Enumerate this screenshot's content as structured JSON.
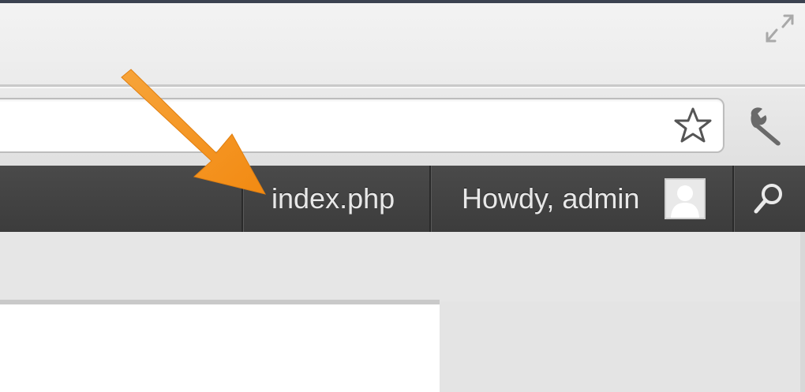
{
  "admin_bar": {
    "page_link": "index.php",
    "greeting": "Howdy, admin"
  },
  "icons": {
    "fullscreen": "fullscreen-icon",
    "bookmark": "star-icon",
    "settings": "wrench-icon",
    "avatar": "avatar-icon",
    "search": "search-icon"
  },
  "colors": {
    "admin_bar": "#464646",
    "annotation_arrow": "#f7931e"
  }
}
